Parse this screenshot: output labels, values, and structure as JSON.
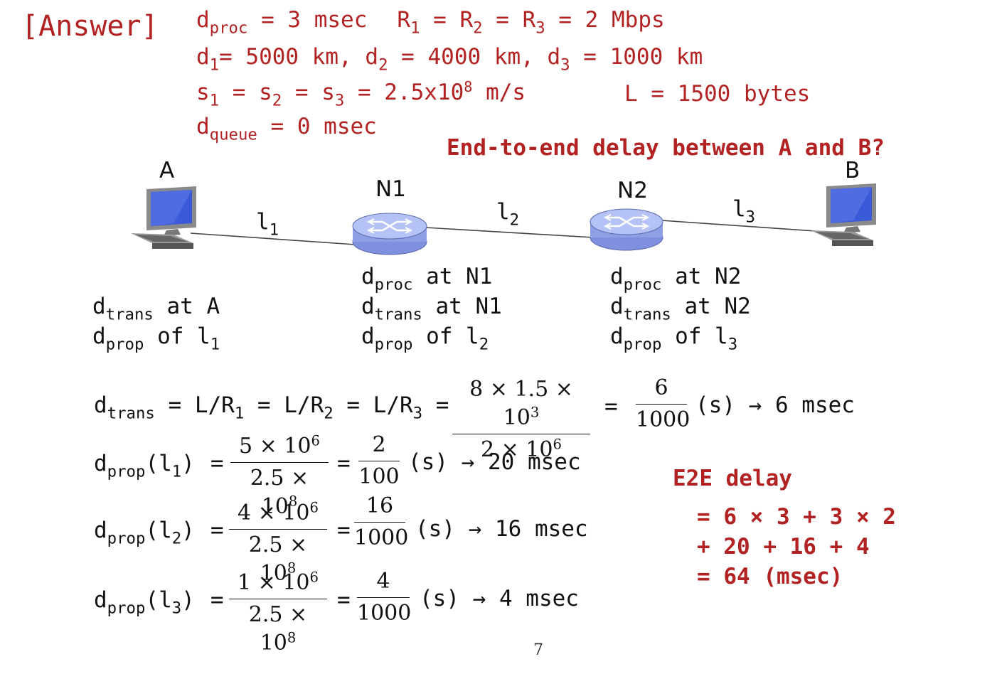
{
  "answer_label": "[Answer]",
  "given": {
    "line1": {
      "d": "d",
      "proc_sub": "proc",
      "proc_val": " = 3 msec",
      "R_eq": "R",
      "s1": "1",
      "eq1": " = R",
      "s2": "2",
      "eq2": " = R",
      "s3": "3",
      "rate": " = 2 Mbps"
    },
    "line2": {
      "d1": "d",
      "s1": "1",
      "v1": "= 5000 km, d",
      "s2": "2",
      "v2": " = 4000 km, d",
      "s3": "3",
      "v3": " = 1000 km"
    },
    "line3": {
      "s": "s",
      "s1": "1",
      "eq1": " = s",
      "s2": "2",
      "eq2": " = s",
      "s3": "3",
      "v": " = 2.5x10",
      "exp": "8",
      "unit": " m/s",
      "L": "L = 1500 bytes"
    },
    "line4": {
      "d": "d",
      "sub": "queue",
      "val": " = 0 msec"
    }
  },
  "question": "End-to-end delay between A and B?",
  "nodes": {
    "A": "A",
    "B": "B",
    "N1": "N1",
    "N2": "N2"
  },
  "links": {
    "l1": {
      "base": "l",
      "sub": "1"
    },
    "l2": {
      "base": "l",
      "sub": "2"
    },
    "l3": {
      "base": "l",
      "sub": "3"
    }
  },
  "components": {
    "A": [
      {
        "d": "d",
        "sub": "trans",
        "rest": " at A",
        "rsub": ""
      },
      {
        "d": "d",
        "sub": "prop",
        "rest": " of l",
        "rsub": "1"
      }
    ],
    "N1": [
      {
        "d": "d",
        "sub": "proc",
        "rest": " at N1",
        "rsub": ""
      },
      {
        "d": "d",
        "sub": "trans",
        "rest": " at N1",
        "rsub": ""
      },
      {
        "d": "d",
        "sub": "prop",
        "rest": " of l",
        "rsub": "2"
      }
    ],
    "N2": [
      {
        "d": "d",
        "sub": "proc",
        "rest": " at N2",
        "rsub": ""
      },
      {
        "d": "d",
        "sub": "trans",
        "rest": " at N2",
        "rsub": ""
      },
      {
        "d": "d",
        "sub": "prop",
        "rest": " of l",
        "rsub": "3"
      }
    ]
  },
  "trans_eq": {
    "lhs_d": "d",
    "lhs_sub": "trans",
    "lhs_rest1": " = L/R",
    "s1": "1",
    "r2": " = L/R",
    "s2": "2",
    "r3": " = L/R",
    "s3": "3",
    "eqsign": " =",
    "frac1_num": "8 × 1.5 × 10",
    "frac1_num_exp": "3",
    "frac1_den": "2 × 10",
    "frac1_den_exp": "6",
    "eq2": "=",
    "frac2_num": "6",
    "frac2_den": "1000",
    "result": "(s) → 6 msec"
  },
  "prop_eqs": [
    {
      "d": "d",
      "sub": "prop",
      "arg": "(l",
      "arg_sub": "1",
      "arg_close": ")",
      "eq": "=",
      "num": "5 × 10",
      "num_exp": "6",
      "den": "2.5 × 10",
      "den_exp": "8",
      "eq2": "=",
      "num2": "2",
      "den2": "100",
      "result": "(s) → 20 msec"
    },
    {
      "d": "d",
      "sub": "prop",
      "arg": "(l",
      "arg_sub": "2",
      "arg_close": ")",
      "eq": "=",
      "num": "4 × 10",
      "num_exp": "6",
      "den": "2.5 × 10",
      "den_exp": "8",
      "eq2": "=",
      "num2": "16",
      "den2": "1000",
      "result": "(s) → 16 msec"
    },
    {
      "d": "d",
      "sub": "prop",
      "arg": "(l",
      "arg_sub": "3",
      "arg_close": ")",
      "eq": "=",
      "num": "1 × 10",
      "num_exp": "6",
      "den": "2.5 × 10",
      "den_exp": "8",
      "eq2": "=",
      "num2": "4",
      "den2": "1000",
      "result": "(s) → 4 msec"
    }
  ],
  "e2e": {
    "title": "E2E delay",
    "line1": "= 6 × 3 + 3 × 2",
    "line2": "+ 20 + 16 + 4",
    "line3": "= 64 (msec)"
  },
  "page_number": "7",
  "colors": {
    "accent": "#b22222",
    "router": "#a9b8f0",
    "link": "#444444"
  },
  "icons": {
    "host": "desktop-computer-icon",
    "router": "router-icon"
  }
}
